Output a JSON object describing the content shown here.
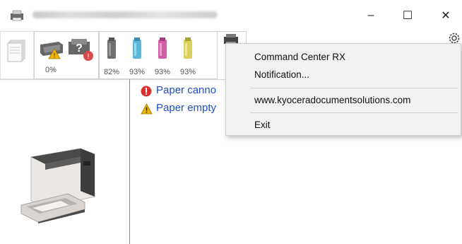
{
  "window": {
    "title": "",
    "controls": {
      "minimize": "–",
      "maximize": "☐",
      "close": "✕"
    }
  },
  "tabs": {
    "paper_percent": "0%",
    "toner": [
      {
        "color": "#7a7a7a",
        "label": "82%"
      },
      {
        "color": "#5bb8d8",
        "label": "93%"
      },
      {
        "color": "#d65ca8",
        "label": "93%"
      },
      {
        "color": "#d8d25a",
        "label": "93%"
      }
    ]
  },
  "status": {
    "messages": [
      {
        "icon": "error-icon",
        "text": "Paper canno"
      },
      {
        "icon": "warning-icon",
        "text": "Paper empty"
      }
    ]
  },
  "context_menu": {
    "items": [
      "Command Center RX",
      "Notification...",
      "www.kyoceradocumentsolutions.com",
      "Exit"
    ]
  },
  "colors": {
    "link": "#1f4ec4",
    "error": "#d93030",
    "warning": "#f0b400",
    "menu_bg": "#f2f2f2"
  }
}
